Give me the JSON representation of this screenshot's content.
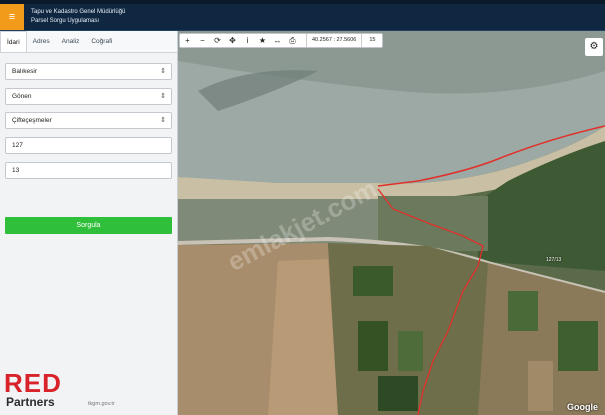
{
  "app": {
    "menu_icon": "hamburger-icon",
    "title_line1": "Tapu ve Kadastro Genel Müdürlüğü",
    "title_line2": "Parsel Sorgu Uygulaması"
  },
  "sidebar": {
    "tabs": [
      {
        "label": "İdari",
        "active": true
      },
      {
        "label": "Adres",
        "active": false
      },
      {
        "label": "Analiz",
        "active": false
      },
      {
        "label": "Coğrafi",
        "active": false
      }
    ],
    "province": "Balıkesir",
    "district": "Gönen",
    "neighborhood": "Çifteçeşmeler",
    "block": "127",
    "parcel": "13",
    "query_label": "Sorgula",
    "footer": "tkgm.gov.tr"
  },
  "toolbar": {
    "icons": [
      "plus-icon",
      "minus-icon",
      "refresh-icon",
      "locate-icon",
      "info-icon",
      "star-icon",
      "measure-icon",
      "print-icon"
    ],
    "coords": "40.2567 : 27.5606",
    "zoom": "15"
  },
  "map": {
    "parcel_label": "127/13",
    "watermark": "emlakjet.com",
    "google_label": "Google",
    "settings_icon": "gear-icon",
    "boundary_color": "#e0302a"
  },
  "logo": {
    "red": "RED",
    "partners": "Partners"
  }
}
